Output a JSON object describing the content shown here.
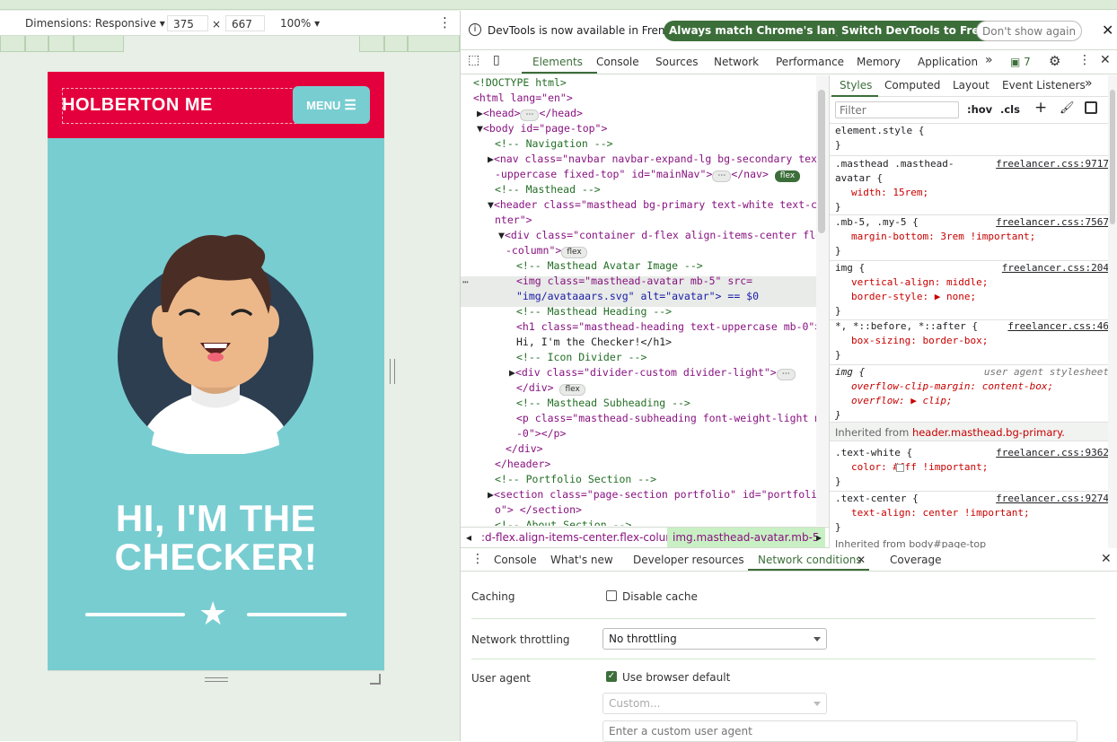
{
  "device_toolbar": {
    "dimensions_label": "Dimensions: Responsive ▾",
    "width": "375",
    "times": "×",
    "height": "667",
    "zoom": "100% ▾"
  },
  "page": {
    "brand": "HOLBERTON ME",
    "menu_label": "MENU",
    "heading_line1": "HI, I'M THE",
    "heading_line2": "CHECKER!"
  },
  "infobar": {
    "message": "DevTools is now available in French!",
    "btn_match": "Always match Chrome's language",
    "btn_switch": "Switch DevTools to French",
    "btn_dismiss": "Don't show again"
  },
  "tabs": [
    "Elements",
    "Console",
    "Sources",
    "Network",
    "Performance",
    "Memory",
    "Application"
  ],
  "issues_count": "7",
  "elements_lines": [
    "<!DOCTYPE html>",
    "<html lang=\"en\">",
    "<head>",
    "<body id=\"page-top\">",
    "<!-- Navigation -->",
    "<nav class=\"navbar navbar-expand-lg bg-secondary text",
    "-uppercase fixed-top\" id=\"mainNav\">",
    "<!-- Masthead -->",
    "<header class=\"masthead bg-primary text-white text-ce",
    "nter\">",
    "<div class=\"container d-flex align-items-center flex",
    "-column\">",
    "<!-- Masthead Avatar Image -->",
    "<img class=\"masthead-avatar mb-5\" src=",
    "\"img/avataaars.svg\" alt=\"avatar\"> == $0",
    "<!-- Masthead Heading -->",
    "<h1 class=\"masthead-heading text-uppercase mb-0\">",
    "Hi, I'm the Checker!</h1>",
    "<!-- Icon Divider -->",
    "<div class=\"divider-custom divider-light\">",
    "</div>",
    "<!-- Masthead Subheading -->",
    "<p class=\"masthead-subheading font-weight-light mb",
    "-0\"></p>",
    "</div>",
    "</header>",
    "<!-- Portfolio Section -->",
    "<section class=\"page-section portfolio\" id=\"portfoli",
    "o\"> </section>",
    "<!-- About Section -->"
  ],
  "breadcrumb": {
    "item1": ":d-flex.align-items-center.flex-column",
    "item2": "img.masthead-avatar.mb-5"
  },
  "styles_tabs": [
    "Styles",
    "Computed",
    "Layout",
    "Event Listeners"
  ],
  "styles_filter_placeholder": "Filter",
  "styles_hov": ":hov",
  "styles_cls": ".cls",
  "style_rules": [
    {
      "selector": "element.style {",
      "source": "",
      "props": []
    },
    {
      "selector": ".masthead .masthead-",
      "source": "freelancer.css:9717",
      "selector2": "avatar {",
      "props": [
        "width: 15rem;"
      ]
    },
    {
      "selector": ".mb-5, .my-5 {",
      "source": "freelancer.css:7567",
      "props": [
        "margin-bottom: 3rem !important;"
      ]
    },
    {
      "selector": "img {",
      "source": "freelancer.css:204",
      "props": [
        "vertical-align: middle;",
        "border-style: ▶ none;"
      ]
    },
    {
      "selector": "*, *::before, *::after {",
      "source": "freelancer.css:46",
      "props": [
        "box-sizing: border-box;"
      ]
    },
    {
      "selector": "img {",
      "source": "user agent stylesheet",
      "props": [
        "overflow-clip-margin: content-box;",
        "overflow: ▶ clip;"
      ]
    },
    {
      "selector": ".text-white {",
      "source": "freelancer.css:9362",
      "props": [
        "color: #fff !important;"
      ]
    },
    {
      "selector": ".text-center {",
      "source": "freelancer.css:9274",
      "props": [
        "text-align: center !important;"
      ]
    }
  ],
  "inherited_label": "Inherited from",
  "inherited_from": "header.masthead.bg-primary.",
  "inherited_label2": "Inherited from body#page-top",
  "drawer_tabs": [
    "Console",
    "What's new",
    "Developer resources",
    "Network conditions",
    "Coverage"
  ],
  "network_conditions": {
    "caching_label": "Caching",
    "disable_cache": "Disable cache",
    "throttling_label": "Network throttling",
    "throttling_value": "No throttling",
    "user_agent_label": "User agent",
    "use_browser_default": "Use browser default",
    "custom_placeholder": "Custom...",
    "custom_ua_placeholder": "Enter a custom user agent"
  }
}
